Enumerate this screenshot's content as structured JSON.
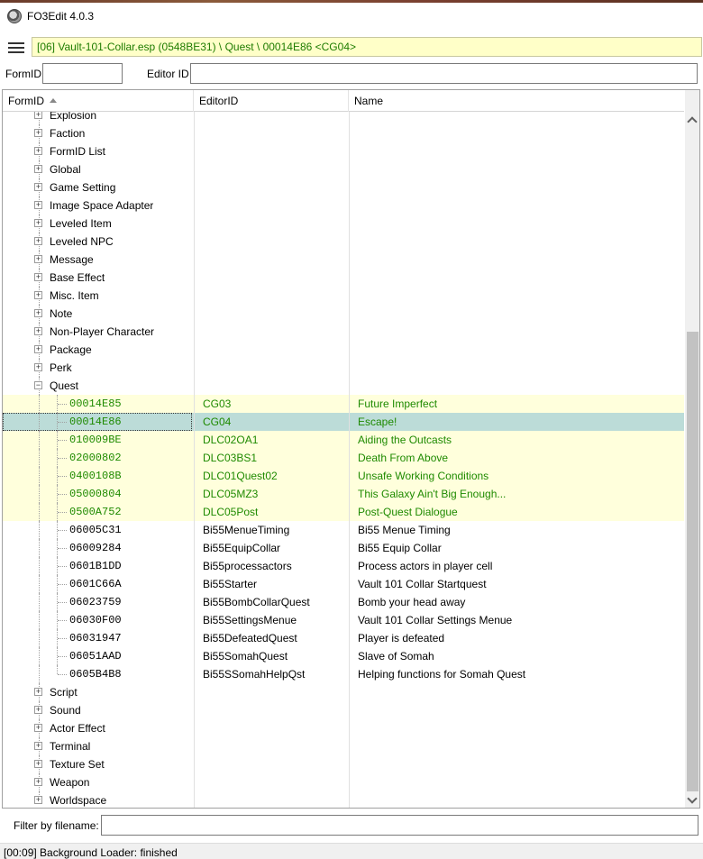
{
  "window": {
    "title": "FO3Edit 4.0.3"
  },
  "path_bar": {
    "text": "[06] Vault-101-Collar.esp (0548BE31) \\ Quest \\ 00014E86 <CG04>"
  },
  "search": {
    "formid_label": "FormID",
    "editorid_label": "Editor ID",
    "formid_value": "",
    "editorid_value": ""
  },
  "columns": {
    "formid": "FormID",
    "editorid": "EditorID",
    "name": "Name"
  },
  "groups_before": [
    "Explosion",
    "Faction",
    "FormID List",
    "Global",
    "Game Setting",
    "Image Space Adapter",
    "Leveled Item",
    "Leveled NPC",
    "Message",
    "Base Effect",
    "Misc. Item",
    "Note",
    "Non-Player Character",
    "Package",
    "Perk"
  ],
  "expanded_group": "Quest",
  "quest_records": [
    {
      "formid": "00014E85",
      "editorid": "CG03",
      "name": "Future Imperfect",
      "style": "hl"
    },
    {
      "formid": "00014E86",
      "editorid": "CG04",
      "name": "Escape!",
      "style": "sel"
    },
    {
      "formid": "010009BE",
      "editorid": "DLC02OA1",
      "name": "Aiding the Outcasts",
      "style": "hl"
    },
    {
      "formid": "02000802",
      "editorid": "DLC03BS1",
      "name": "Death From Above",
      "style": "hl"
    },
    {
      "formid": "0400108B",
      "editorid": "DLC01Quest02",
      "name": "Unsafe Working Conditions",
      "style": "hl"
    },
    {
      "formid": "05000804",
      "editorid": "DLC05MZ3",
      "name": "This Galaxy Ain't Big Enough...",
      "style": "hl"
    },
    {
      "formid": "0500A752",
      "editorid": "DLC05Post",
      "name": "Post-Quest Dialogue",
      "style": "hl"
    },
    {
      "formid": "06005C31",
      "editorid": "Bi55MenueTiming",
      "name": "Bi55 Menue Timing",
      "style": ""
    },
    {
      "formid": "06009284",
      "editorid": "Bi55EquipCollar",
      "name": "Bi55 Equip Collar",
      "style": ""
    },
    {
      "formid": "0601B1DD",
      "editorid": "Bi55processactors",
      "name": "Process actors in player cell",
      "style": ""
    },
    {
      "formid": "0601C66A",
      "editorid": "Bi55Starter",
      "name": "Vault 101 Collar Startquest",
      "style": ""
    },
    {
      "formid": "06023759",
      "editorid": "Bi55BombCollarQuest",
      "name": "Bomb your head away",
      "style": ""
    },
    {
      "formid": "06030F00",
      "editorid": "Bi55SettingsMenue",
      "name": "Vault 101 Collar Settings Menue",
      "style": ""
    },
    {
      "formid": "06031947",
      "editorid": "Bi55DefeatedQuest",
      "name": "Player is defeated",
      "style": ""
    },
    {
      "formid": "06051AAD",
      "editorid": "Bi55SomahQuest",
      "name": "Slave of Somah",
      "style": ""
    },
    {
      "formid": "0605B4B8",
      "editorid": "Bi55SSomahHelpQst",
      "name": "Helping functions for Somah Quest",
      "style": ""
    }
  ],
  "groups_after": [
    "Script",
    "Sound",
    "Actor Effect",
    "Terminal",
    "Texture Set",
    "Weapon",
    "Worldspace"
  ],
  "filter": {
    "label": "Filter by filename:",
    "value": ""
  },
  "status": {
    "text": "[00:09] Background Loader: finished"
  },
  "colors": {
    "highlight_row": "#ffffdc",
    "selected_row": "#bcdcd8",
    "override_text": "#1e8a00",
    "path_bg": "#ffffc8"
  }
}
